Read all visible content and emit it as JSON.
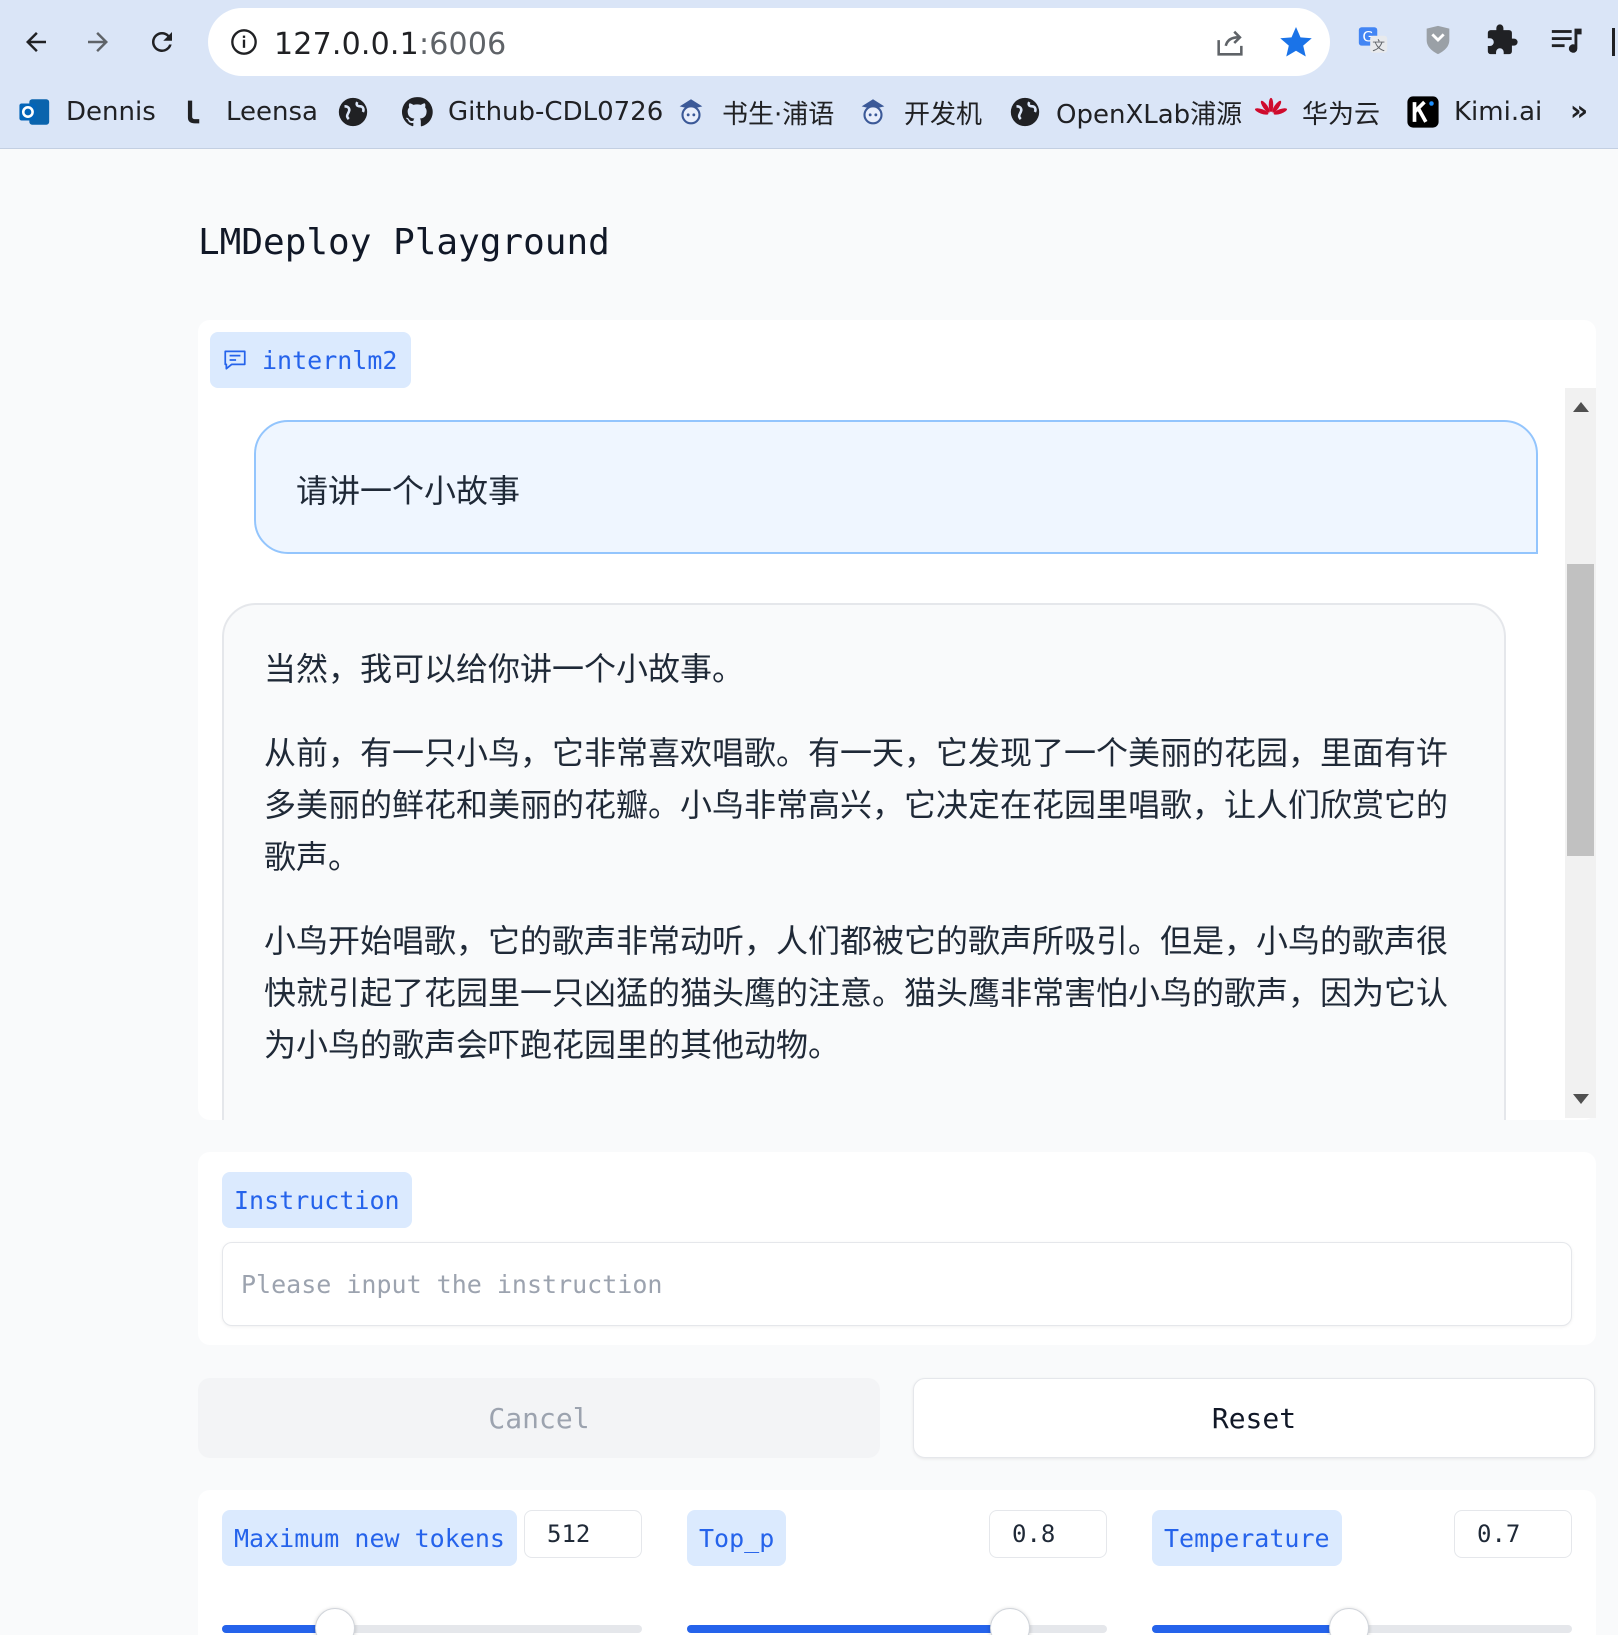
{
  "browser": {
    "url_host": "127.0.0.1",
    "url_port": ":6006",
    "bookmarks": [
      {
        "label": "Dennis",
        "icon": "outlook-icon"
      },
      {
        "label": "Leensa",
        "icon": "leensa-icon"
      },
      {
        "label": "",
        "icon": "globe-icon"
      },
      {
        "label": "Github-CDL0726",
        "icon": "github-icon"
      },
      {
        "label": "书生·浦语",
        "icon": "shusheng-icon"
      },
      {
        "label": "开发机",
        "icon": "shusheng-icon"
      },
      {
        "label": "OpenXLab浦源",
        "icon": "globe-icon"
      },
      {
        "label": "华为云",
        "icon": "huawei-icon"
      },
      {
        "label": "Kimi.ai",
        "icon": "kimi-icon"
      }
    ],
    "more_label": "»",
    "accent_color": "#1a73e8"
  },
  "page": {
    "title": "LMDeploy Playground"
  },
  "chat": {
    "label": "internlm2",
    "user_message": "请讲一个小故事",
    "bot_paragraphs": [
      "当然，我可以给你讲一个小故事。",
      "从前，有一只小鸟，它非常喜欢唱歌。有一天，它发现了一个美丽的花园，里面有许多美丽的鲜花和美丽的花瓣。小鸟非常高兴，它决定在花园里唱歌，让人们欣赏它的歌声。",
      "小鸟开始唱歌，它的歌声非常动听，人们都被它的歌声所吸引。但是，小鸟的歌声很快就引起了花园里一只凶猛的猫头鹰的注意。猫头鹰非常害怕小鸟的歌声，因为它认为小鸟的歌声会吓跑花园里的其他动物。"
    ]
  },
  "instruction": {
    "label": "Instruction",
    "placeholder": "Please input the instruction",
    "value": ""
  },
  "buttons": {
    "cancel": "Cancel",
    "reset": "Reset"
  },
  "sliders": [
    {
      "label": "Maximum new tokens",
      "value": "512",
      "fraction": 0.27
    },
    {
      "label": "Top_p",
      "value": "0.8",
      "fraction": 0.77
    },
    {
      "label": "Temperature",
      "value": "0.7",
      "fraction": 0.47
    }
  ],
  "colors": {
    "primary": "#2563eb",
    "label_bg": "#dbeafe",
    "user_bubble_bg": "#eff6ff",
    "user_bubble_border": "#93c5fd"
  }
}
